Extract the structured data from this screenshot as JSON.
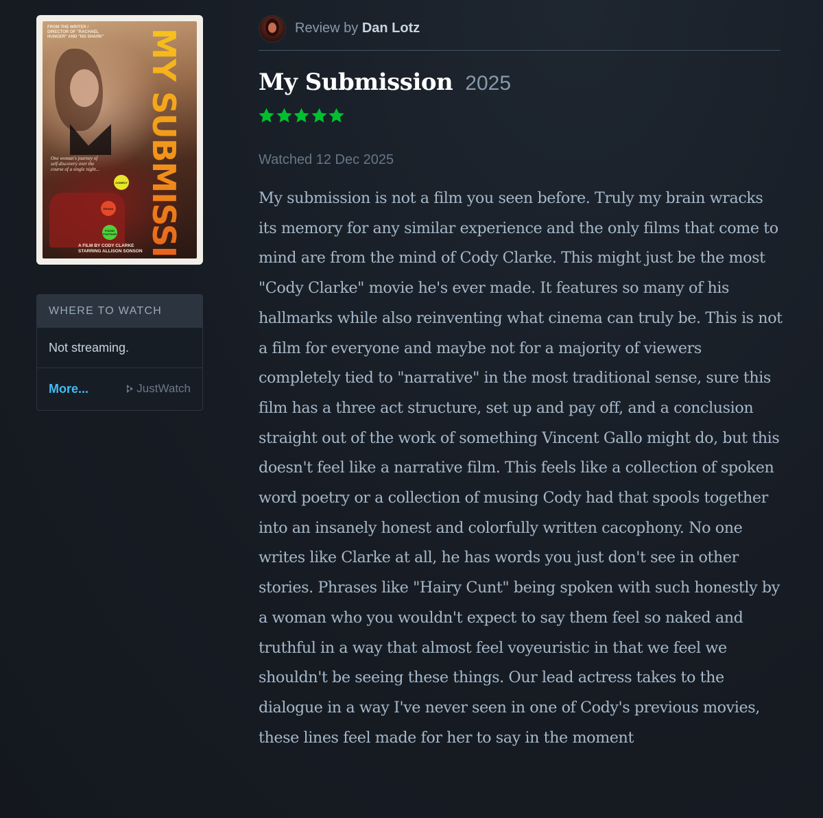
{
  "poster": {
    "title": "MY SUBMISSION",
    "credit_top": "FROM THE WRITER / DIRECTOR OF \"RACHAEL HUNGER\" AND \"NO SHARK\"",
    "tagline": "One woman's journey of self-discovery over the course of a single night...",
    "badges": [
      "COMEDY",
      "DRAMA",
      "FOUND FOOTAGE"
    ],
    "director_line1": "a film by CODY CLARKE",
    "director_line2": "starring ALLISON SONSON"
  },
  "where_to_watch": {
    "header": "WHERE TO WATCH",
    "status": "Not streaming.",
    "more_label": "More...",
    "brand": "JustWatch"
  },
  "review": {
    "by_prefix": "Review by",
    "author": "Dan Lotz",
    "film_title": "My Submission",
    "year": "2025",
    "rating_stars": 5,
    "watched": "Watched 12 Dec 2025",
    "body": "My submission is not a film you seen before. Truly my brain wracks its memory for any similar experience and the only films that come to mind are from the mind of Cody Clarke. This might just be the most \"Cody Clarke\" movie he's ever made. It features so many of his hallmarks while also reinventing what cinema can truly be. This is not a film for everyone and maybe not for a majority of viewers completely tied to \"narrative\" in the most traditional sense, sure this film has a three act structure, set up and pay off, and a conclusion straight out of the work of something Vincent Gallo might do, but this doesn't feel like a narrative film. This feels like a collection of spoken word poetry or a collection of musing Cody had that spools together into an insanely honest and colorfully written cacophony. No one writes like Clarke at all, he has words you just don't see in other stories. Phrases like \"Hairy Cunt\" being spoken with such honestly by a woman who you wouldn't expect to say them feel so naked and truthful in a way that almost feel voyeuristic in that we feel we shouldn't be seeing these things. Our lead actress takes to the dialogue in a way I've never seen in one of Cody's previous movies, these lines feel made for her to say in the moment"
  },
  "colors": {
    "background": "#171c24",
    "star_green": "#00c030",
    "link_blue": "#40bcf4",
    "title_white": "#ffffff"
  }
}
